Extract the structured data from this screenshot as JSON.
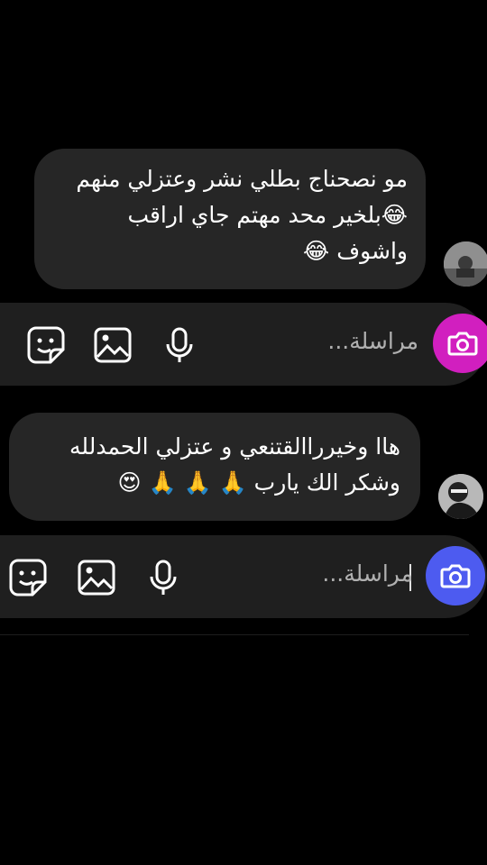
{
  "messages": [
    {
      "lines": [
        "مو نصحناج بطلي نشر وعتزلي منهم",
        "😂بلخير محد مهتم جاي اراقب",
        "واشوف 😂"
      ]
    },
    {
      "lines": [
        "هاا وخيرراالقتنعي و عتزلي الحمدلله",
        "وشكر الك يارب 🙏 🙏 🙏 😍"
      ]
    }
  ],
  "composer": [
    {
      "placeholder": "مراسلة...",
      "accent": "#d11fbf"
    },
    {
      "placeholder": "مراسلة...",
      "accent": "#4d5bf0"
    }
  ],
  "icons": {
    "camera": "camera-icon",
    "microphone": "microphone-icon",
    "gallery": "gallery-icon",
    "sticker": "sticker-icon"
  }
}
